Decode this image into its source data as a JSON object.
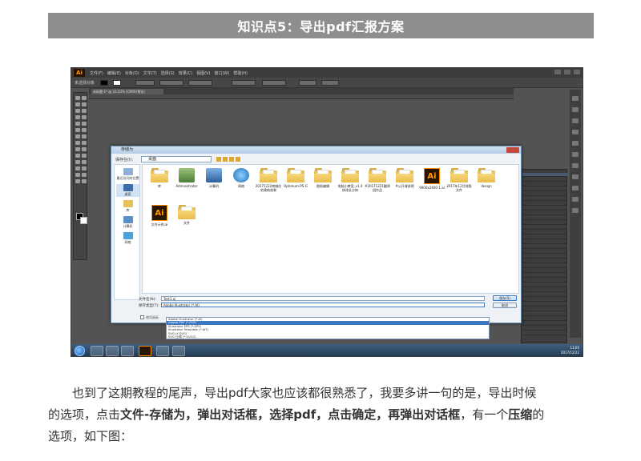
{
  "header": {
    "title": "知识点5：导出pdf汇报方案"
  },
  "screenshot": {
    "app_logo": "Ai",
    "menu_items": [
      "文件(F)",
      "编辑(E)",
      "对象(O)",
      "文字(T)",
      "选择(S)",
      "效果(C)",
      "视图(V)",
      "窗口(W)",
      "帮助(H)"
    ],
    "control_label": "未选择对象",
    "doc_tab": "未标题-1* @ 33.33% (CMYK/预览)",
    "dialog": {
      "title": "存储为",
      "save_in_label": "保存在(I):",
      "save_in_value": "桌面",
      "nav": [
        "最近访问的位置",
        "桌面",
        "库",
        "计算机",
        "网络"
      ],
      "files": [
        {
          "name": "库",
          "kind": "folder"
        },
        {
          "name": "Administrator",
          "kind": "user"
        },
        {
          "name": "计算机",
          "kind": "computer"
        },
        {
          "name": "网络",
          "kind": "network"
        },
        {
          "name": "20171222南城住宅建筑效果",
          "kind": "folder"
        },
        {
          "name": "Optimum-PS-G",
          "kind": "folder"
        },
        {
          "name": "图纸编辑",
          "kind": "folder"
        },
        {
          "name": "电脑小教室_v1.4修改长方体",
          "kind": "folder"
        },
        {
          "name": "#20171221翻译组作品",
          "kind": "folder"
        },
        {
          "name": "#公开课说明",
          "kind": "folder"
        },
        {
          "name": "9000x2400-1.ai",
          "kind": "ai"
        },
        {
          "name": "2017年12月排版文件",
          "kind": "folder"
        },
        {
          "name": "design",
          "kind": "folder"
        },
        {
          "name": "文件示例.ai",
          "kind": "ai"
        },
        {
          "name": "文件",
          "kind": "folder"
        }
      ],
      "filename_label": "文件名(N):",
      "filename_value": "Test1.ai",
      "filetype_label": "保存类型(T):",
      "filetype_value": "Adobe Illustrator (*.AI)",
      "save_button": "保存(S)",
      "cancel_button": "取消",
      "artboard_label": "使用画板",
      "dropdown_options": [
        "Adobe Illustrator (*.AI)",
        "Adobe PDF (*.PDF)",
        "Illustrator EPS (*.EPS)",
        "Illustrator Template (*.AIT)",
        "SVG (*.SVG)",
        "SVG 压缩 (*.SVGZ)"
      ],
      "dropdown_highlight_index": 1
    },
    "clock": {
      "time": "13:05",
      "date": "2017/12/22"
    }
  },
  "body": {
    "line1": "也到了这期教程的尾声，导出pdf大家也应该都很熟悉了，我要多讲一句的是，导出时候",
    "line2_a": "的选项，点击",
    "line2_b": "文件-存储为，弹出对话框，选择pdf，点击确定，再弹出对话框",
    "line2_c": "，有一个",
    "line2_d": "压缩",
    "line2_e": "的",
    "line3": "选项，如下图："
  }
}
